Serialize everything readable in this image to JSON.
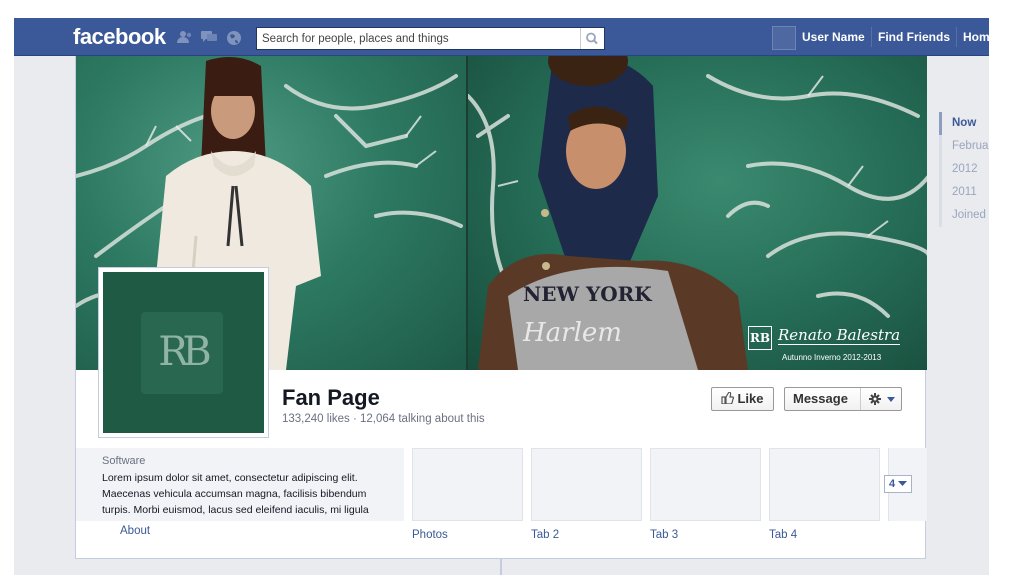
{
  "topbar": {
    "logo": "facebook",
    "search_placeholder": "Search for people, places and things",
    "user_name": "User Name",
    "find_friends": "Find Friends",
    "home": "Home"
  },
  "cover": {
    "brand_mark": "RB",
    "brand_name": "Renato Balestra",
    "brand_subtitle": "Autunno Inverno 2012-2013"
  },
  "profile": {
    "pic_mark": "RB",
    "name": "Fan Page",
    "stats": "133,240 likes · 12,064 talking about this"
  },
  "actions": {
    "like": "Like",
    "message": "Message"
  },
  "about": {
    "category": "Software",
    "description": "Lorem ipsum dolor sit amet, consectetur adipiscing elit. Maecenas vehicula accumsan magna, facilisis bibendum turpis. Morbi euismod, lacus sed eleifend iaculis, mi ligula dictum purus, vitae",
    "link": "About"
  },
  "tabs": [
    {
      "label": "Photos"
    },
    {
      "label": "Tab 2"
    },
    {
      "label": "Tab 3"
    },
    {
      "label": "Tab 4"
    }
  ],
  "more_tabs": "4",
  "timeline": [
    {
      "label": "Now"
    },
    {
      "label": "February"
    },
    {
      "label": "2012"
    },
    {
      "label": "2011"
    },
    {
      "label": "Joined Facebook"
    }
  ],
  "colors": {
    "facebook_blue": "#3b5998",
    "cover_green": "#2e7a62"
  }
}
